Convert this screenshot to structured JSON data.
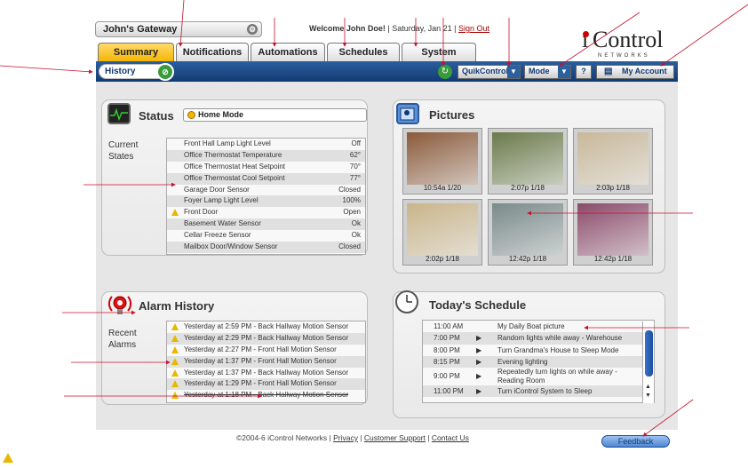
{
  "header": {
    "gateway_name": "John's Gateway",
    "welcome_label": "Welcome",
    "user_name": "John Doe!",
    "date": "Saturday, Jan 21",
    "sign_out": "Sign Out"
  },
  "logo": {
    "main": "Control",
    "sub": "NETWORKS"
  },
  "tabs": [
    {
      "label": "Summary"
    },
    {
      "label": "Notifications"
    },
    {
      "label": "Automations"
    },
    {
      "label": "Schedules"
    },
    {
      "label": "System"
    }
  ],
  "toolbar": {
    "history_label": "History",
    "quikcontrol_label": "QuikControl",
    "mode_label": "Mode",
    "help_label": "?",
    "account_label": "My Account"
  },
  "status": {
    "title": "Status",
    "mode": "Home Mode",
    "side_label": "Current States",
    "rows": [
      {
        "name": "Front Hall Lamp Light Level",
        "value": "Off",
        "warn": false
      },
      {
        "name": "Office Thermostat Temperature",
        "value": "62°",
        "warn": false
      },
      {
        "name": "Office Thermostat Heat Setpoint",
        "value": "70°",
        "warn": false
      },
      {
        "name": "Office Thermostat Cool Setpoint",
        "value": "77°",
        "warn": false
      },
      {
        "name": "Garage Door Sensor",
        "value": "Closed",
        "warn": false
      },
      {
        "name": "Foyer Lamp Light Level",
        "value": "100%",
        "warn": false
      },
      {
        "name": "Front Door",
        "value": "Open",
        "warn": true
      },
      {
        "name": "Basement Water Sensor",
        "value": "Ok",
        "warn": false
      },
      {
        "name": "Cellar Freeze Sensor",
        "value": "Ok",
        "warn": false
      },
      {
        "name": "Mailbox Door/Window Sensor",
        "value": "Closed",
        "warn": false
      }
    ]
  },
  "pictures": {
    "title": "Pictures",
    "items": [
      {
        "caption": "10:54a 1/20",
        "color": "#8a5a3a"
      },
      {
        "caption": "2:07p 1/18",
        "color": "#6a7a4a"
      },
      {
        "caption": "2:03p 1/18",
        "color": "#c8b89a"
      },
      {
        "caption": "2:02p 1/18",
        "color": "#c9b58a"
      },
      {
        "caption": "12:42p 1/18",
        "color": "#7a8a8a"
      },
      {
        "caption": "12:42p 1/18",
        "color": "#8a4a6a"
      }
    ]
  },
  "alarms": {
    "title": "Alarm History",
    "side_label": "Recent Alarms",
    "rows": [
      "Yesterday at 2:59 PM - Back Hallway Motion Sensor",
      "Yesterday at 2:29 PM - Back Hallway Motion Sensor",
      "Yesterday at 2:27 PM - Front Hall Motion Sensor",
      "Yesterday at 1:37 PM - Front Hall Motion Sensor",
      "Yesterday at 1:37 PM - Back Hallway Motion Sensor",
      "Yesterday at 1:29 PM - Front Hall Motion Sensor",
      "Yesterday at 1:18 PM - Back Hallway Motion Sensor"
    ]
  },
  "schedule": {
    "title": "Today's Schedule",
    "rows": [
      {
        "time": "11:00 AM",
        "event": "My Daily Boat picture",
        "play": false
      },
      {
        "time": "7:00 PM",
        "event": "Random lights while away - Warehouse",
        "play": true
      },
      {
        "time": "8:00 PM",
        "event": "Turn Grandma's House to Sleep Mode",
        "play": true
      },
      {
        "time": "8:15 PM",
        "event": "Evening lighting",
        "play": true
      },
      {
        "time": "9:00 PM",
        "event": "Repeatedly turn lights on while away - Reading Room",
        "play": true
      },
      {
        "time": "11:00 PM",
        "event": "Turn iControl System to Sleep",
        "play": true
      }
    ]
  },
  "footer": {
    "copyright": "©2004-6 iControl Networks",
    "privacy": "Privacy",
    "support": "Customer Support",
    "contact": "Contact Us",
    "feedback": "Feedback"
  },
  "colors": {
    "nav": "#123a73",
    "active_tab": "#f4b400",
    "warning": "#e6b800"
  }
}
